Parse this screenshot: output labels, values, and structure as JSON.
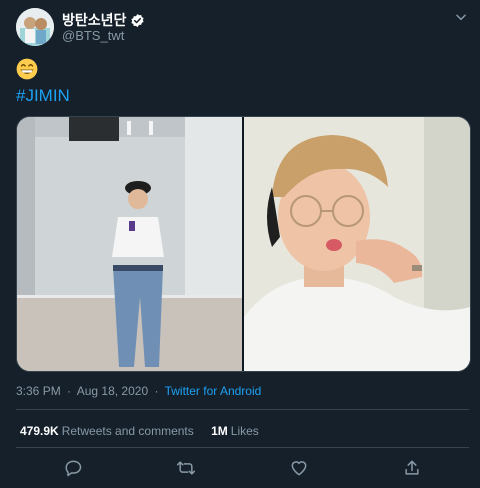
{
  "tweet": {
    "display_name": "방탄소년단",
    "handle": "@BTS_twt",
    "emoji": "😁",
    "hashtag": "#JIMIN",
    "time": "3:36 PM",
    "date": "Aug 18, 2020",
    "separator": "·",
    "source": "Twitter for Android"
  },
  "stats": {
    "retweets_count": "479.9K",
    "retweets_label": "Retweets and comments",
    "likes_count": "1M",
    "likes_label": "Likes"
  },
  "icons": {
    "verified": "verified-badge-icon",
    "more": "chevron-down-icon",
    "reply": "reply-icon",
    "retweet": "retweet-icon",
    "like": "heart-icon",
    "share": "share-icon"
  },
  "colors": {
    "background": "#15202b",
    "accent": "#1da1f2",
    "secondary_text": "#8899a6",
    "border": "#38444d"
  }
}
